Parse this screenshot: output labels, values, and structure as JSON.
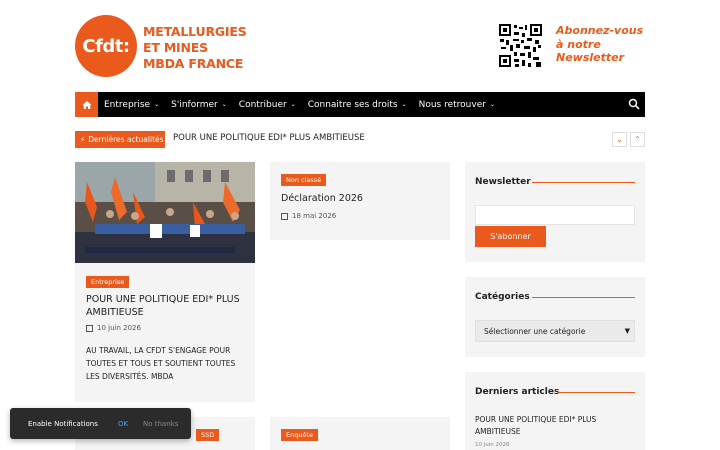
{
  "header": {
    "logo_mark": "Cfdt:",
    "logo_lines": [
      "METALLURGIES",
      "ET MINES",
      "MBDA FRANCE"
    ],
    "promo_lines": [
      "Abonnez-vous",
      "à notre",
      "Newsletter"
    ]
  },
  "nav": {
    "items": [
      {
        "label": "Entreprise",
        "has_dropdown": true
      },
      {
        "label": "S'informer",
        "has_dropdown": true
      },
      {
        "label": "Contribuer",
        "has_dropdown": true
      },
      {
        "label": "Connaitre ses droits",
        "has_dropdown": true
      },
      {
        "label": "Nous retrouver",
        "has_dropdown": true
      }
    ],
    "home_icon": "home-icon",
    "search_icon": "search-icon"
  },
  "ticker": {
    "label": "Dernières actualités",
    "text": "POUR UNE POLITIQUE EDI* PLUS AMBITIEUSE"
  },
  "posts": [
    {
      "tag": "Entreprise",
      "title": "POUR UNE POLITIQUE EDI* PLUS AMBITIEUSE",
      "date": "10 juin 2026",
      "excerpt": "AU TRAVAIL, LA CFDT S'ENGAGE POUR TOUTES ET TOUS ET SOUTIENT TOUTES LES DIVERSITÉS. MBDA"
    },
    {
      "tag": "Non classé",
      "title": "Déclaration 2026",
      "date": "18 mai 2026"
    },
    {
      "tag": "SSD"
    },
    {
      "tag": "Enquête"
    }
  ],
  "sidebar": {
    "newsletter": {
      "title": "Newsletter",
      "button": "S'abonner"
    },
    "categories": {
      "title": "Catégories",
      "select_value": "Sélectionner une catégorie"
    },
    "recent": {
      "title": "Derniers articles",
      "link": "POUR UNE POLITIQUE EDI* PLUS AMBITIEUSE",
      "date": "10 juin 2026"
    }
  },
  "notification": {
    "text": "Enable Notifications",
    "ok": "OK",
    "no": "No thanks"
  },
  "colors": {
    "accent": "#ea5a1c",
    "nav_bg": "#000000",
    "card_bg": "#f4f4f4"
  }
}
